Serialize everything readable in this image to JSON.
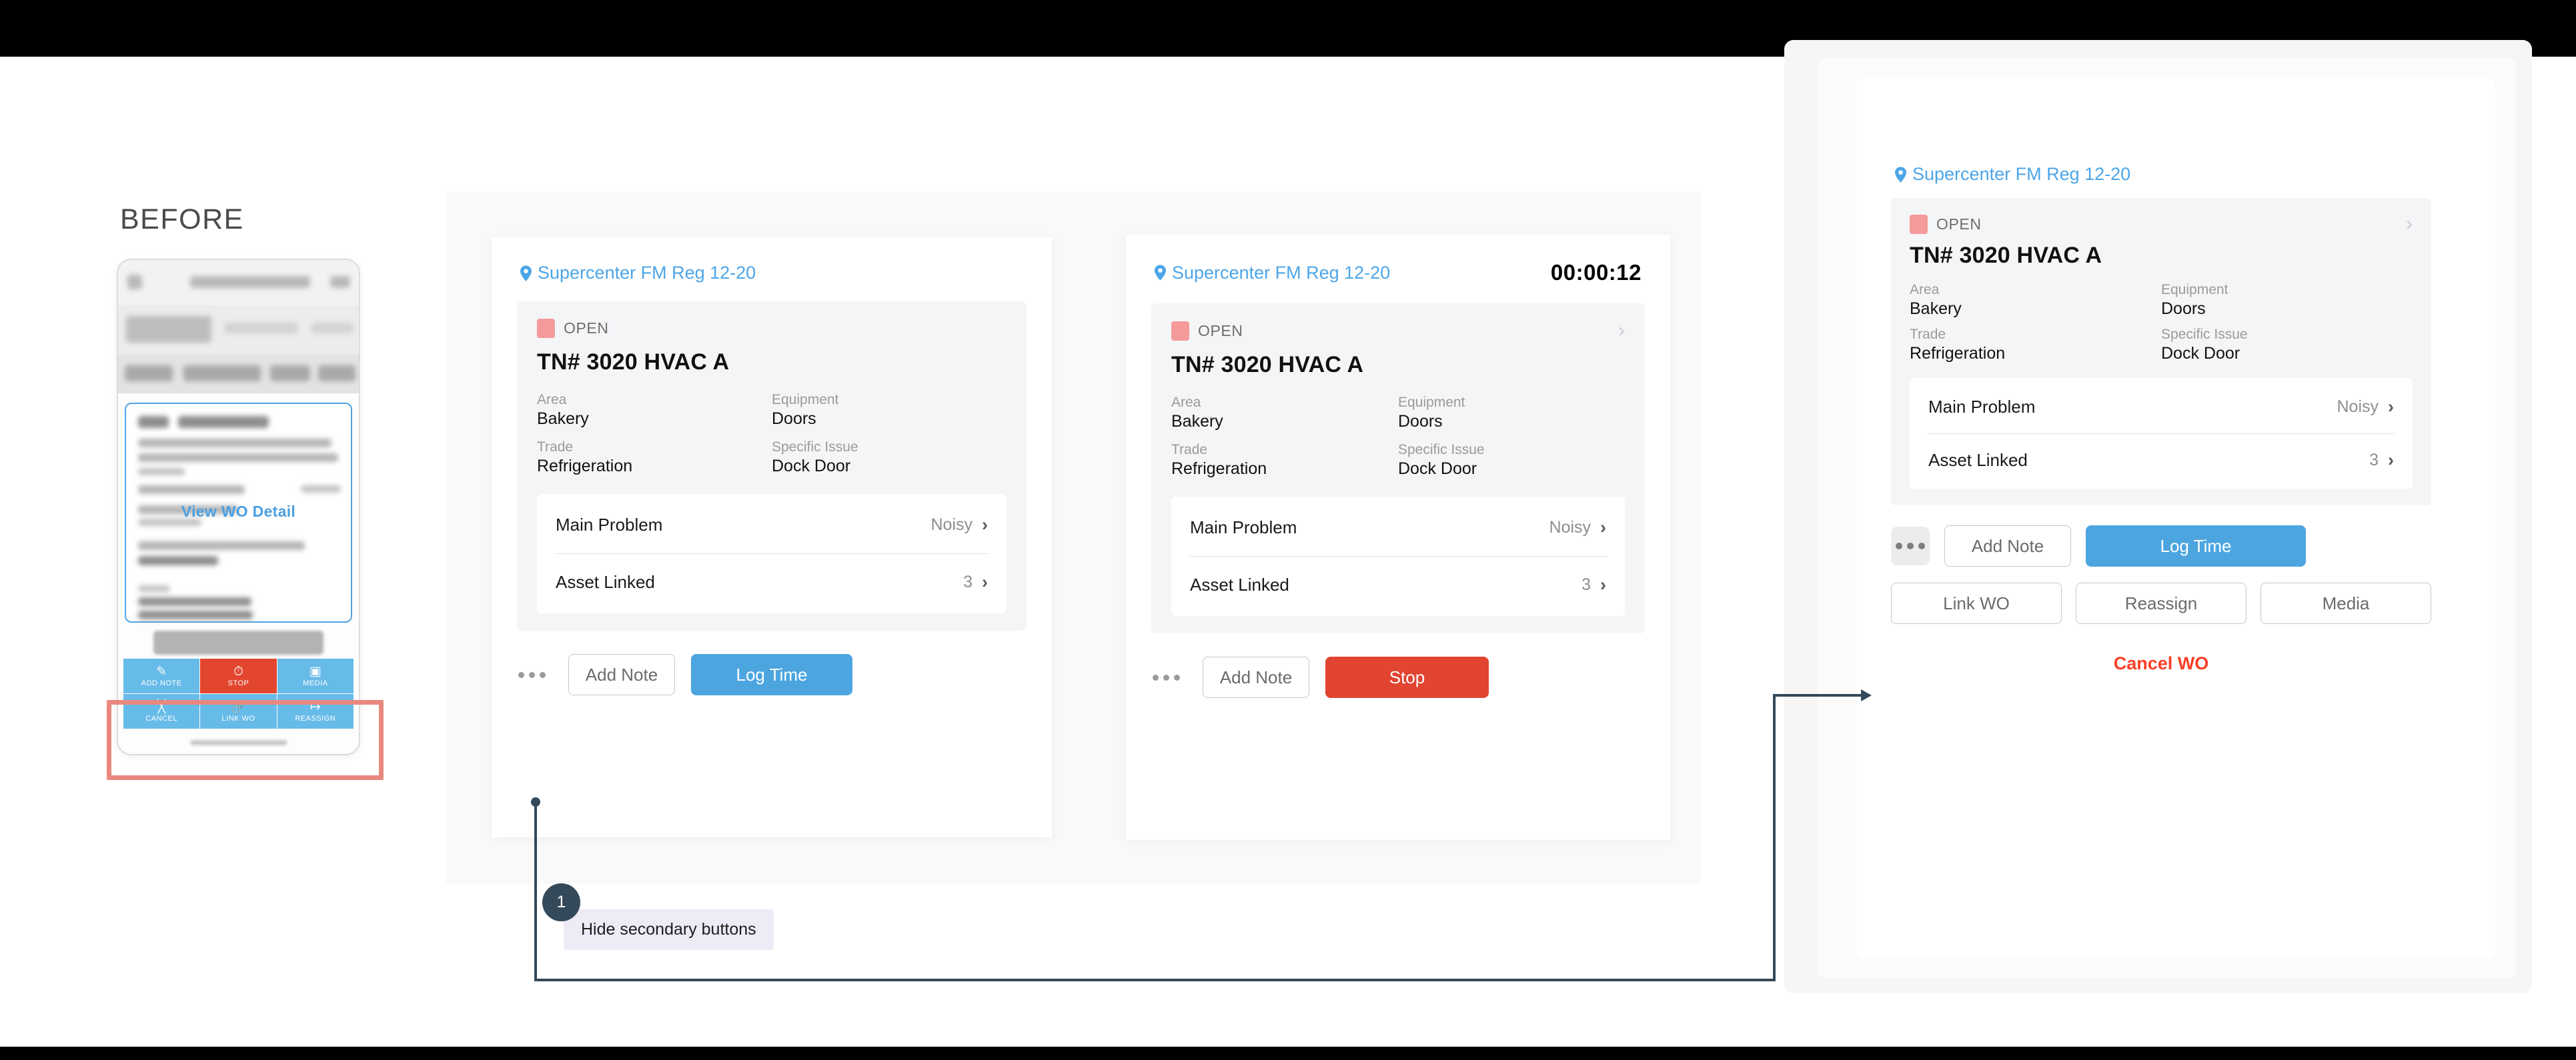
{
  "before": {
    "title": "BEFORE",
    "view_wo_detail": "View WO Detail",
    "action_buttons": [
      {
        "label": "ADD NOTE",
        "icon": "note-edit-icon",
        "variant": "blue"
      },
      {
        "label": "STOP",
        "icon": "clock-icon",
        "variant": "red"
      },
      {
        "label": "MEDIA",
        "icon": "camera-icon",
        "variant": "blue"
      },
      {
        "label": "CANCEL",
        "icon": "cancel-box-icon",
        "variant": "blue"
      },
      {
        "label": "LINK WO",
        "icon": "link-icon",
        "variant": "blue"
      },
      {
        "label": "REASSIGN",
        "icon": "export-arrow-icon",
        "variant": "blue"
      }
    ]
  },
  "work_order": {
    "location": "Supercenter FM Reg 12-20",
    "location_icon": "map-pin-icon",
    "status": "OPEN",
    "title": "TN# 3020 HVAC A",
    "fields": [
      {
        "label": "Area",
        "value": "Bakery"
      },
      {
        "label": "Equipment",
        "value": "Doors"
      },
      {
        "label": "Trade",
        "value": "Refrigeration"
      },
      {
        "label": "Specific Issue",
        "value": "Dock Door"
      }
    ],
    "rows": [
      {
        "label": "Main Problem",
        "value": "Noisy",
        "chevron": "chevron-right-icon"
      },
      {
        "label": "Asset Linked",
        "value": "3",
        "chevron": "chevron-right-icon"
      }
    ]
  },
  "card_collapsed": {
    "overflow_icon": "ellipsis-icon",
    "secondary_label": "Add Note",
    "primary_label": "Log Time"
  },
  "card_running": {
    "timer": "00:00:12",
    "overflow_icon": "ellipsis-icon",
    "secondary_label": "Add Note",
    "primary_label": "Stop"
  },
  "card_expanded": {
    "overflow_icon": "ellipsis-icon",
    "secondary_label": "Add Note",
    "primary_label": "Log Time",
    "extra_buttons": [
      "Link WO",
      "Reassign",
      "Media"
    ],
    "cancel_label": "Cancel WO"
  },
  "annotation": {
    "number": "1",
    "text": "Hide secondary buttons"
  },
  "colors": {
    "accent_blue": "#4da5e0",
    "link_blue": "#4ca5e8",
    "danger_red": "#e14430",
    "cancel_red": "#f93f25",
    "status_pink": "#f49a9a",
    "annotation_navy": "#34495a",
    "annotation_bg": "#eeeaf6"
  }
}
